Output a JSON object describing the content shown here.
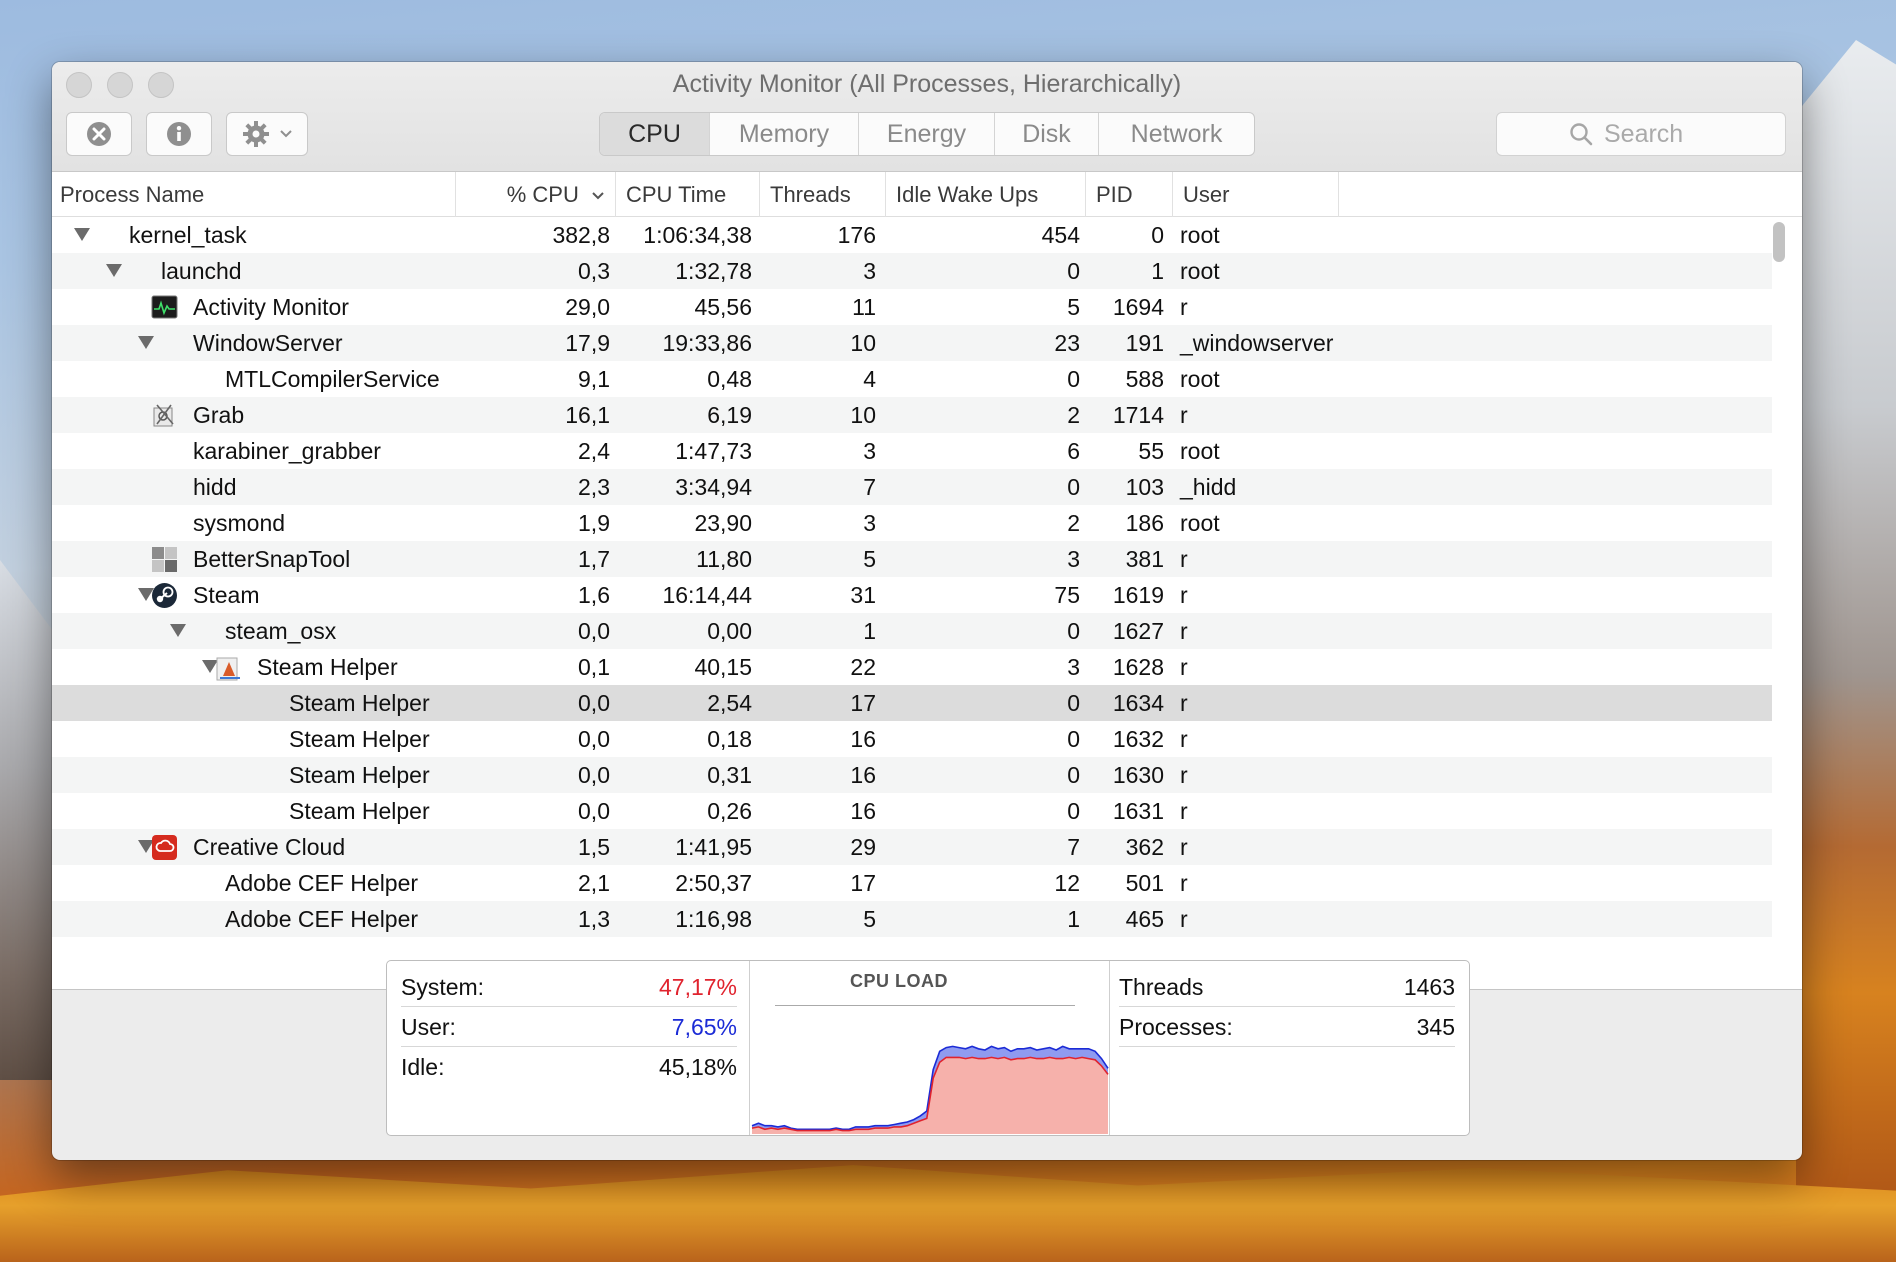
{
  "window": {
    "title": "Activity Monitor (All Processes, Hierarchically)"
  },
  "toolbar": {
    "stop_icon": "x-circle-icon",
    "info_icon": "info-icon",
    "gear_icon": "gear-icon"
  },
  "tabs": [
    {
      "label": "CPU",
      "active": true
    },
    {
      "label": "Memory",
      "active": false
    },
    {
      "label": "Energy",
      "active": false
    },
    {
      "label": "Disk",
      "active": false
    },
    {
      "label": "Network",
      "active": false
    }
  ],
  "search": {
    "placeholder": "Search"
  },
  "columns": {
    "process_name": "Process Name",
    "cpu": "% CPU",
    "cpu_time": "CPU Time",
    "threads": "Threads",
    "idle_wake_ups": "Idle Wake Ups",
    "pid": "PID",
    "user": "User"
  },
  "processes": [
    {
      "name": "kernel_task",
      "cpu": "382,8",
      "cpu_time": "1:06:34,38",
      "threads": "176",
      "idle": "454",
      "pid": "0",
      "user": "root",
      "depth": 0,
      "expanded": true,
      "icon": ""
    },
    {
      "name": "launchd",
      "cpu": "0,3",
      "cpu_time": "1:32,78",
      "threads": "3",
      "idle": "0",
      "pid": "1",
      "user": "root",
      "depth": 1,
      "expanded": true,
      "icon": ""
    },
    {
      "name": "Activity Monitor",
      "cpu": "29,0",
      "cpu_time": "45,56",
      "threads": "11",
      "idle": "5",
      "pid": "1694",
      "user": "r",
      "depth": 2,
      "expanded": false,
      "icon": "activity-monitor-icon"
    },
    {
      "name": "WindowServer",
      "cpu": "17,9",
      "cpu_time": "19:33,86",
      "threads": "10",
      "idle": "23",
      "pid": "191",
      "user": "_windowserver",
      "depth": 2,
      "expanded": true,
      "icon": ""
    },
    {
      "name": "MTLCompilerService",
      "cpu": "9,1",
      "cpu_time": "0,48",
      "threads": "4",
      "idle": "0",
      "pid": "588",
      "user": "root",
      "depth": 3,
      "expanded": false,
      "icon": ""
    },
    {
      "name": "Grab",
      "cpu": "16,1",
      "cpu_time": "6,19",
      "threads": "10",
      "idle": "2",
      "pid": "1714",
      "user": "r",
      "depth": 2,
      "expanded": false,
      "icon": "grab-icon"
    },
    {
      "name": "karabiner_grabber",
      "cpu": "2,4",
      "cpu_time": "1:47,73",
      "threads": "3",
      "idle": "6",
      "pid": "55",
      "user": "root",
      "depth": 2,
      "expanded": false,
      "icon": ""
    },
    {
      "name": "hidd",
      "cpu": "2,3",
      "cpu_time": "3:34,94",
      "threads": "7",
      "idle": "0",
      "pid": "103",
      "user": "_hidd",
      "depth": 2,
      "expanded": false,
      "icon": ""
    },
    {
      "name": "sysmond",
      "cpu": "1,9",
      "cpu_time": "23,90",
      "threads": "3",
      "idle": "2",
      "pid": "186",
      "user": "root",
      "depth": 2,
      "expanded": false,
      "icon": ""
    },
    {
      "name": "BetterSnapTool",
      "cpu": "1,7",
      "cpu_time": "11,80",
      "threads": "5",
      "idle": "3",
      "pid": "381",
      "user": "r",
      "depth": 2,
      "expanded": false,
      "icon": "bettersnaptool-icon"
    },
    {
      "name": "Steam",
      "cpu": "1,6",
      "cpu_time": "16:14,44",
      "threads": "31",
      "idle": "75",
      "pid": "1619",
      "user": "r",
      "depth": 2,
      "expanded": true,
      "icon": "steam-icon"
    },
    {
      "name": "steam_osx",
      "cpu": "0,0",
      "cpu_time": "0,00",
      "threads": "1",
      "idle": "0",
      "pid": "1627",
      "user": "r",
      "depth": 3,
      "expanded": true,
      "icon": ""
    },
    {
      "name": "Steam Helper",
      "cpu": "0,1",
      "cpu_time": "40,15",
      "threads": "22",
      "idle": "3",
      "pid": "1628",
      "user": "r",
      "depth": 4,
      "expanded": true,
      "icon": "steam-helper-icon"
    },
    {
      "name": "Steam Helper",
      "cpu": "0,0",
      "cpu_time": "2,54",
      "threads": "17",
      "idle": "0",
      "pid": "1634",
      "user": "r",
      "depth": 5,
      "expanded": false,
      "icon": "",
      "selected": true
    },
    {
      "name": "Steam Helper",
      "cpu": "0,0",
      "cpu_time": "0,18",
      "threads": "16",
      "idle": "0",
      "pid": "1632",
      "user": "r",
      "depth": 5,
      "expanded": false,
      "icon": ""
    },
    {
      "name": "Steam Helper",
      "cpu": "0,0",
      "cpu_time": "0,31",
      "threads": "16",
      "idle": "0",
      "pid": "1630",
      "user": "r",
      "depth": 5,
      "expanded": false,
      "icon": ""
    },
    {
      "name": "Steam Helper",
      "cpu": "0,0",
      "cpu_time": "0,26",
      "threads": "16",
      "idle": "0",
      "pid": "1631",
      "user": "r",
      "depth": 5,
      "expanded": false,
      "icon": ""
    },
    {
      "name": "Creative Cloud",
      "cpu": "1,5",
      "cpu_time": "1:41,95",
      "threads": "29",
      "idle": "7",
      "pid": "362",
      "user": "r",
      "depth": 2,
      "expanded": true,
      "icon": "creative-cloud-icon"
    },
    {
      "name": "Adobe CEF Helper",
      "cpu": "2,1",
      "cpu_time": "2:50,37",
      "threads": "17",
      "idle": "12",
      "pid": "501",
      "user": "r",
      "depth": 3,
      "expanded": false,
      "icon": ""
    },
    {
      "name": "Adobe CEF Helper",
      "cpu": "1,3",
      "cpu_time": "1:16,98",
      "threads": "5",
      "idle": "1",
      "pid": "465",
      "user": "r",
      "depth": 3,
      "expanded": false,
      "icon": ""
    }
  ],
  "summary": {
    "system_label": "System:",
    "system_value": "47,17%",
    "user_label": "User:",
    "user_value": "7,65%",
    "idle_label": "Idle:",
    "idle_value": "45,18%",
    "cpu_load_title": "CPU LOAD",
    "threads_label": "Threads",
    "threads_value": "1463",
    "processes_label": "Processes:",
    "processes_value": "345"
  },
  "colors": {
    "system": "#e0232e",
    "user": "#1b2bd6",
    "system_fill": "#f6b1ab",
    "user_fill": "#8f9bf0"
  },
  "cpu_load_history": {
    "system": [
      4,
      5,
      3,
      4,
      3,
      4,
      3,
      2,
      2,
      2,
      2,
      2,
      2,
      3,
      2,
      2,
      3,
      3,
      3,
      4,
      4,
      4,
      5,
      5,
      6,
      8,
      10,
      12,
      45,
      58,
      62,
      62,
      62,
      61,
      62,
      61,
      61,
      62,
      61,
      62,
      60,
      61,
      61,
      62,
      61,
      61,
      62,
      61,
      61,
      62,
      61,
      62,
      61,
      60,
      55,
      48
    ],
    "user": [
      2,
      3,
      3,
      2,
      2,
      2,
      1,
      1,
      1,
      1,
      1,
      1,
      1,
      1,
      1,
      1,
      2,
      2,
      2,
      2,
      2,
      2,
      2,
      3,
      3,
      3,
      4,
      6,
      7,
      9,
      8,
      9,
      8,
      8,
      9,
      8,
      7,
      9,
      8,
      8,
      7,
      8,
      8,
      8,
      7,
      8,
      8,
      7,
      10,
      7,
      8,
      7,
      8,
      7,
      6,
      5
    ]
  }
}
